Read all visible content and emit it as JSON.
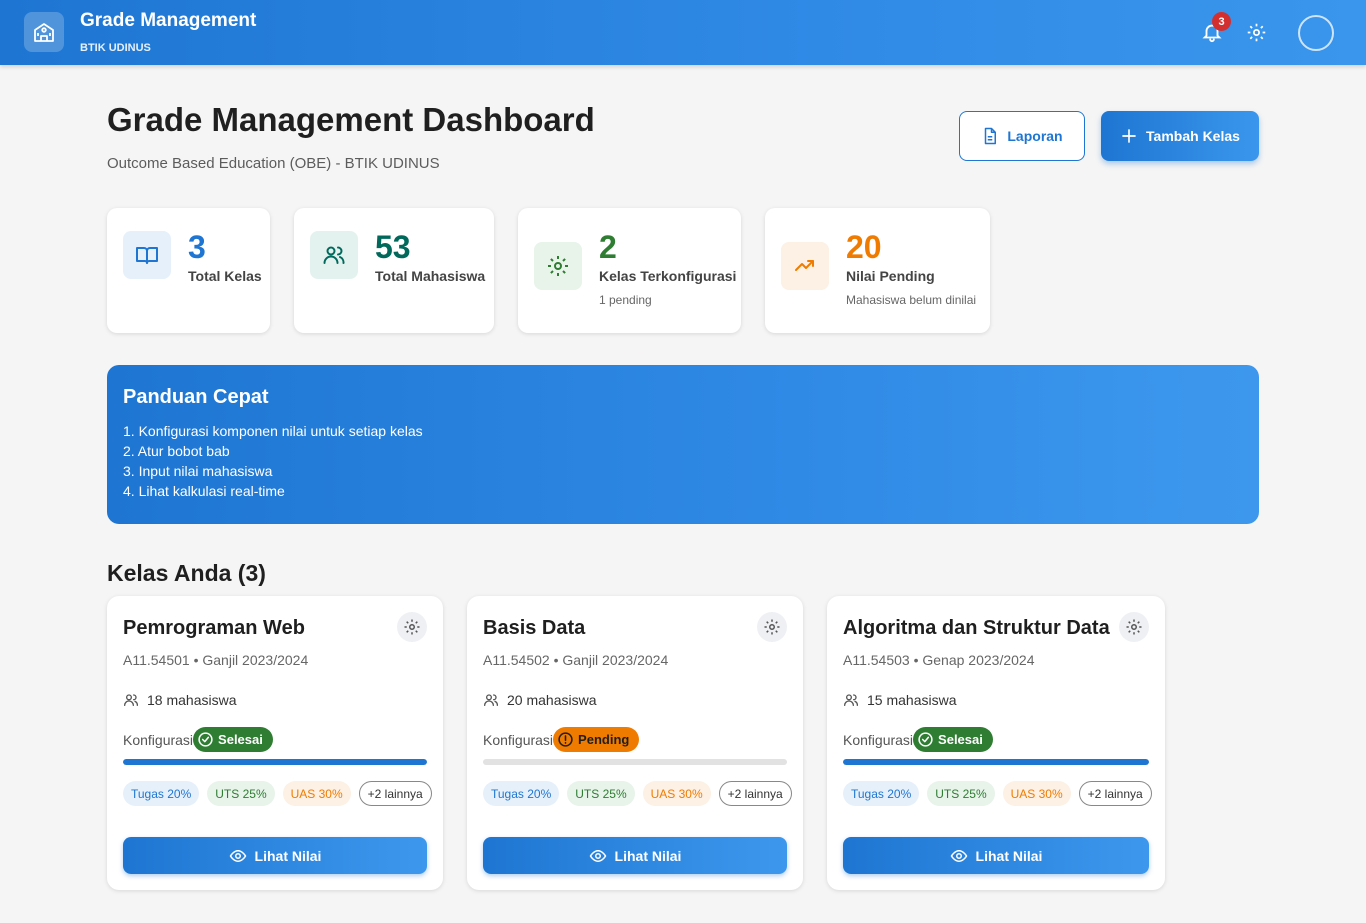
{
  "app": {
    "title": "Grade Management",
    "subtitle": "BTIK UDINUS",
    "notification_count": "3"
  },
  "header": {
    "title": "Grade Management Dashboard",
    "subtitle": "Outcome Based Education (OBE) - BTIK UDINUS",
    "report_button": "Laporan",
    "add_button": "Tambah Kelas"
  },
  "stats": [
    {
      "value": "3",
      "label": "Total Kelas",
      "hint": "",
      "color": "#1e76d2",
      "icon": "book-icon"
    },
    {
      "value": "53",
      "label": "Total Mahasiswa",
      "hint": "",
      "color": "#00695c",
      "icon": "users-icon"
    },
    {
      "value": "2",
      "label": "Kelas Terkonfigurasi",
      "hint": "1 pending",
      "color": "#2e7d32",
      "icon": "gear-icon"
    },
    {
      "value": "20",
      "label": "Nilai Pending",
      "hint": "Mahasiswa belum dinilai",
      "color": "#ef7c00",
      "icon": "trending-up-icon"
    }
  ],
  "guide": {
    "title": "Panduan Cepat",
    "steps": [
      "1. Konfigurasi komponen nilai untuk setiap kelas",
      "2. Atur bobot bab",
      "3. Input nilai mahasiswa",
      "4. Lihat kalkulasi real-time"
    ]
  },
  "classes_section": {
    "title": "Kelas Anda (3)"
  },
  "classes": [
    {
      "name": "Pemrograman Web",
      "meta": "A11.54501 • Ganjil 2023/2024",
      "students": "18 mahasiswa",
      "config_label": "Konfigurasi",
      "status": "Selesai",
      "progress": 1.0,
      "chips": [
        "Tugas 20%",
        "UTS 25%",
        "UAS 30%",
        "+2 lainnya"
      ],
      "button": "Lihat Nilai"
    },
    {
      "name": "Basis Data",
      "meta": "A11.54502 • Ganjil 2023/2024",
      "students": "20 mahasiswa",
      "config_label": "Konfigurasi",
      "status": "Pending",
      "progress": 0.0,
      "chips": [
        "Tugas 20%",
        "UTS 25%",
        "UAS 30%",
        "+2 lainnya"
      ],
      "button": "Lihat Nilai"
    },
    {
      "name": "Algoritma dan Struktur Data",
      "meta": "A11.54503 • Genap 2023/2024",
      "students": "15 mahasiswa",
      "config_label": "Konfigurasi",
      "status": "Selesai",
      "progress": 1.0,
      "chips": [
        "Tugas 20%",
        "UTS 25%",
        "UAS 30%",
        "+2 lainnya"
      ],
      "button": "Lihat Nilai"
    }
  ],
  "colors": {
    "primary": "#1e76d2",
    "success": "#2e7d32",
    "warning": "#ef7c00",
    "danger": "#d32f2f"
  }
}
